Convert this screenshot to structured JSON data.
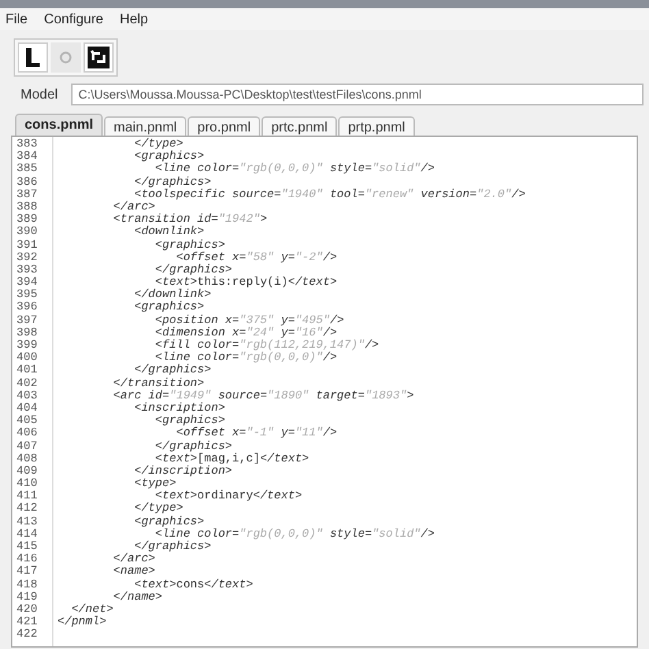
{
  "menu": [
    "File",
    "Configure",
    "Help"
  ],
  "toolbar": [
    {
      "kind": "edit",
      "disabled": false
    },
    {
      "kind": "circle",
      "disabled": true
    },
    {
      "kind": "refresh",
      "disabled": false
    }
  ],
  "model": {
    "label": "Model",
    "value": "C:\\Users\\Moussa.Moussa-PC\\Desktop\\test\\testFiles\\cons.pnml"
  },
  "tabs": [
    {
      "label": "cons.pnml",
      "selected": true
    },
    {
      "label": "main.pnml",
      "selected": false
    },
    {
      "label": "pro.pnml",
      "selected": false
    },
    {
      "label": "prtc.pnml",
      "selected": false
    },
    {
      "label": "prtp.pnml",
      "selected": false
    }
  ],
  "lines": [
    {
      "number": "383",
      "segments": [
        {
          "kind": "tag",
          "text": "           </type>"
        }
      ]
    },
    {
      "number": "384",
      "segments": [
        {
          "kind": "tag",
          "text": "           <graphics>"
        }
      ]
    },
    {
      "number": "385",
      "segments": [
        {
          "kind": "tag",
          "text": "              <line color="
        },
        {
          "kind": "value",
          "text": "\"rgb(0,0,0)\""
        },
        {
          "kind": "tag",
          "text": " style="
        },
        {
          "kind": "value",
          "text": "\"solid\""
        },
        {
          "kind": "tag",
          "text": "/>"
        }
      ]
    },
    {
      "number": "386",
      "segments": [
        {
          "kind": "tag",
          "text": "           </graphics>"
        }
      ]
    },
    {
      "number": "387",
      "segments": [
        {
          "kind": "tag",
          "text": "           <toolspecific source="
        },
        {
          "kind": "value",
          "text": "\"1940\""
        },
        {
          "kind": "tag",
          "text": " tool="
        },
        {
          "kind": "value",
          "text": "\"renew\""
        },
        {
          "kind": "tag",
          "text": " version="
        },
        {
          "kind": "value",
          "text": "\"2.0\""
        },
        {
          "kind": "tag",
          "text": "/>"
        }
      ]
    },
    {
      "number": "388",
      "segments": [
        {
          "kind": "tag",
          "text": "        </arc>"
        }
      ]
    },
    {
      "number": "389",
      "segments": [
        {
          "kind": "tag",
          "text": "        <transition id="
        },
        {
          "kind": "value",
          "text": "\"1942\""
        },
        {
          "kind": "tag",
          "text": ">"
        }
      ]
    },
    {
      "number": "390",
      "segments": [
        {
          "kind": "tag",
          "text": "           <downlink>"
        }
      ]
    },
    {
      "number": "391",
      "segments": [
        {
          "kind": "tag",
          "text": "              <graphics>"
        }
      ]
    },
    {
      "number": "392",
      "segments": [
        {
          "kind": "tag",
          "text": "                 <offset x="
        },
        {
          "kind": "value",
          "text": "\"58\""
        },
        {
          "kind": "tag",
          "text": " y="
        },
        {
          "kind": "value",
          "text": "\"-2\""
        },
        {
          "kind": "tag",
          "text": "/>"
        }
      ]
    },
    {
      "number": "393",
      "segments": [
        {
          "kind": "tag",
          "text": "              </graphics>"
        }
      ]
    },
    {
      "number": "394",
      "segments": [
        {
          "kind": "tag",
          "text": "              <text>"
        },
        {
          "kind": "text",
          "text": "this:reply(i)"
        },
        {
          "kind": "tag",
          "text": "</text>"
        }
      ]
    },
    {
      "number": "395",
      "segments": [
        {
          "kind": "tag",
          "text": "           </downlink>"
        }
      ]
    },
    {
      "number": "396",
      "segments": [
        {
          "kind": "tag",
          "text": "           <graphics>"
        }
      ]
    },
    {
      "number": "397",
      "segments": [
        {
          "kind": "tag",
          "text": "              <position x="
        },
        {
          "kind": "value",
          "text": "\"375\""
        },
        {
          "kind": "tag",
          "text": " y="
        },
        {
          "kind": "value",
          "text": "\"495\""
        },
        {
          "kind": "tag",
          "text": "/>"
        }
      ]
    },
    {
      "number": "398",
      "segments": [
        {
          "kind": "tag",
          "text": "              <dimension x="
        },
        {
          "kind": "value",
          "text": "\"24\""
        },
        {
          "kind": "tag",
          "text": " y="
        },
        {
          "kind": "value",
          "text": "\"16\""
        },
        {
          "kind": "tag",
          "text": "/>"
        }
      ]
    },
    {
      "number": "399",
      "segments": [
        {
          "kind": "tag",
          "text": "              <fill color="
        },
        {
          "kind": "value",
          "text": "\"rgb(112,219,147)\""
        },
        {
          "kind": "tag",
          "text": "/>"
        }
      ]
    },
    {
      "number": "400",
      "segments": [
        {
          "kind": "tag",
          "text": "              <line color="
        },
        {
          "kind": "value",
          "text": "\"rgb(0,0,0)\""
        },
        {
          "kind": "tag",
          "text": "/>"
        }
      ]
    },
    {
      "number": "401",
      "segments": [
        {
          "kind": "tag",
          "text": "           </graphics>"
        }
      ]
    },
    {
      "number": "402",
      "segments": [
        {
          "kind": "tag",
          "text": "        </transition>"
        }
      ]
    },
    {
      "number": "403",
      "segments": [
        {
          "kind": "tag",
          "text": "        <arc id="
        },
        {
          "kind": "value",
          "text": "\"1949\""
        },
        {
          "kind": "tag",
          "text": " source="
        },
        {
          "kind": "value",
          "text": "\"1890\""
        },
        {
          "kind": "tag",
          "text": " target="
        },
        {
          "kind": "value",
          "text": "\"1893\""
        },
        {
          "kind": "tag",
          "text": ">"
        }
      ]
    },
    {
      "number": "404",
      "segments": [
        {
          "kind": "tag",
          "text": "           <inscription>"
        }
      ]
    },
    {
      "number": "405",
      "segments": [
        {
          "kind": "tag",
          "text": "              <graphics>"
        }
      ]
    },
    {
      "number": "406",
      "segments": [
        {
          "kind": "tag",
          "text": "                 <offset x="
        },
        {
          "kind": "value",
          "text": "\"-1\""
        },
        {
          "kind": "tag",
          "text": " y="
        },
        {
          "kind": "value",
          "text": "\"11\""
        },
        {
          "kind": "tag",
          "text": "/>"
        }
      ]
    },
    {
      "number": "407",
      "segments": [
        {
          "kind": "tag",
          "text": "              </graphics>"
        }
      ]
    },
    {
      "number": "408",
      "segments": [
        {
          "kind": "tag",
          "text": "              <text>"
        },
        {
          "kind": "text",
          "text": "[mag,i,c]"
        },
        {
          "kind": "tag",
          "text": "</text>"
        }
      ]
    },
    {
      "number": "409",
      "segments": [
        {
          "kind": "tag",
          "text": "           </inscription>"
        }
      ]
    },
    {
      "number": "410",
      "segments": [
        {
          "kind": "tag",
          "text": "           <type>"
        }
      ]
    },
    {
      "number": "411",
      "segments": [
        {
          "kind": "tag",
          "text": "              <text>"
        },
        {
          "kind": "text",
          "text": "ordinary"
        },
        {
          "kind": "tag",
          "text": "</text>"
        }
      ]
    },
    {
      "number": "412",
      "segments": [
        {
          "kind": "tag",
          "text": "           </type>"
        }
      ]
    },
    {
      "number": "413",
      "segments": [
        {
          "kind": "tag",
          "text": "           <graphics>"
        }
      ]
    },
    {
      "number": "414",
      "segments": [
        {
          "kind": "tag",
          "text": "              <line color="
        },
        {
          "kind": "value",
          "text": "\"rgb(0,0,0)\""
        },
        {
          "kind": "tag",
          "text": " style="
        },
        {
          "kind": "value",
          "text": "\"solid\""
        },
        {
          "kind": "tag",
          "text": "/>"
        }
      ]
    },
    {
      "number": "415",
      "segments": [
        {
          "kind": "tag",
          "text": "           </graphics>"
        }
      ]
    },
    {
      "number": "416",
      "segments": [
        {
          "kind": "tag",
          "text": "        </arc>"
        }
      ]
    },
    {
      "number": "417",
      "segments": [
        {
          "kind": "tag",
          "text": "        <name>"
        }
      ]
    },
    {
      "number": "418",
      "segments": [
        {
          "kind": "tag",
          "text": "           <text>"
        },
        {
          "kind": "text",
          "text": "cons"
        },
        {
          "kind": "tag",
          "text": "</text>"
        }
      ]
    },
    {
      "number": "419",
      "segments": [
        {
          "kind": "tag",
          "text": "        </name>"
        }
      ]
    },
    {
      "number": "420",
      "segments": [
        {
          "kind": "tag",
          "text": "  </net>"
        }
      ]
    },
    {
      "number": "421",
      "segments": [
        {
          "kind": "tag",
          "text": "</pnml>"
        }
      ]
    },
    {
      "number": "422"
    }
  ]
}
